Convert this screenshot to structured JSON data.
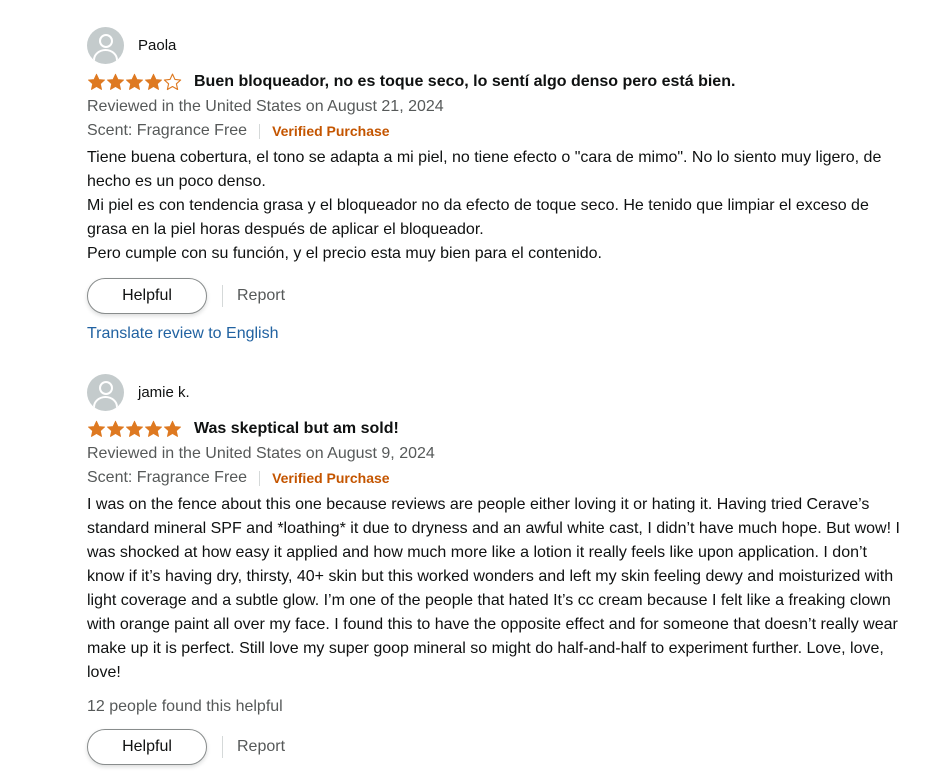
{
  "colors": {
    "star_fill": "#de7921",
    "verified": "#c45500",
    "link": "#2162a1",
    "muted_text": "#565959"
  },
  "reviews": [
    {
      "reviewer_name": "Paola",
      "rating": 4,
      "max_rating": 5,
      "title": "Buen bloqueador, no es toque seco, lo sentí algo denso pero está bien.",
      "date_line": "Reviewed in the United States on August 21, 2024",
      "format": "Scent: Fragrance Free",
      "verified_label": "Verified Purchase",
      "body": [
        "Tiene buena cobertura, el tono se adapta a mi piel, no tiene efecto o \"cara de mimo\". No lo siento muy ligero, de hecho es un poco denso.",
        "Mi piel es con tendencia grasa y el bloqueador no da efecto de toque seco. He tenido que limpiar el exceso de grasa en la piel horas después de aplicar el bloqueador.",
        "Pero cumple con su función, y el precio esta muy bien para el contenido."
      ],
      "helpful_label": "Helpful",
      "report_label": "Report",
      "translate_label": "Translate review to English"
    },
    {
      "reviewer_name": "jamie k.",
      "rating": 5,
      "max_rating": 5,
      "title": "Was skeptical but am sold!",
      "date_line": "Reviewed in the United States on August 9, 2024",
      "format": "Scent: Fragrance Free",
      "verified_label": "Verified Purchase",
      "body": [
        "I was on the fence about this one because reviews are people either loving it or hating it. Having tried Cerave’s standard mineral SPF and *loathing* it due to dryness and an awful white cast, I didn’t have much hope. But wow! I was shocked at how easy it applied and how much more like a lotion it really feels like upon application. I don’t know if it’s having dry, thirsty, 40+ skin but this worked wonders and left my skin feeling dewy and moisturized with light coverage and a subtle glow. I’m one of the people that hated It’s cc cream because I felt like a freaking clown with orange paint all over my face. I found this to have the opposite effect and for someone that doesn’t really wear make up it is perfect. Still love my super goop mineral so might do half-and-half to experiment further. Love, love, love!"
      ],
      "helpful_count": "12 people found this helpful",
      "helpful_label": "Helpful",
      "report_label": "Report"
    }
  ]
}
